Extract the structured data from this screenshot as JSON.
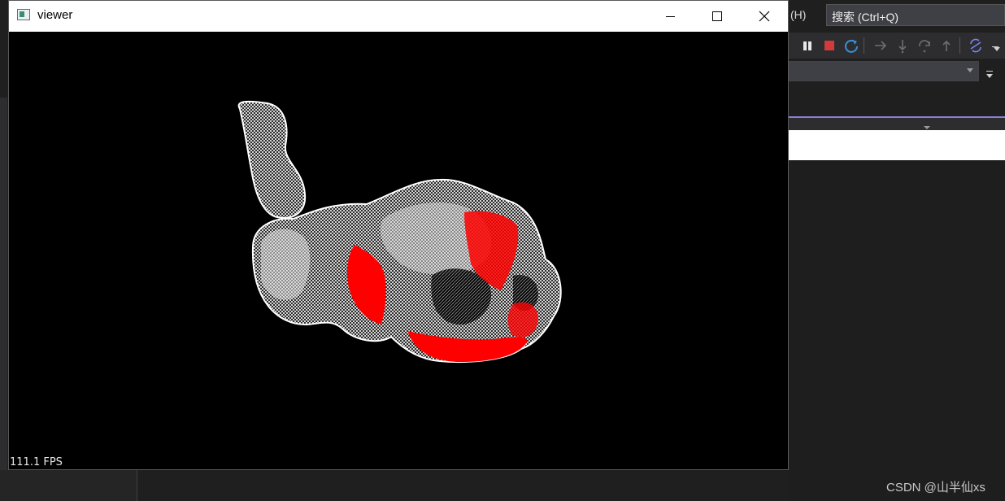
{
  "viewer": {
    "title": "viewer",
    "fps": "111.1 FPS",
    "controls": {
      "minimize": "minimize",
      "maximize": "maximize",
      "close": "close"
    }
  },
  "ide": {
    "menu_help_fragment": "(H)",
    "search_placeholder": "搜索 (Ctrl+Q)",
    "toolbar_icons": [
      "pause-icon",
      "stop-icon",
      "restart-icon",
      "step-into-arrow-icon",
      "step-down-icon",
      "step-over-icon",
      "step-out-icon",
      "hot-reload-icon"
    ]
  },
  "watermark": "CSDN @山半仙xs",
  "colors": {
    "viewer_bg": "#000000",
    "point_cloud": "#ffffff",
    "highlight": "#ff0000",
    "ide_bg": "#1f1f1f",
    "accent_line": "#8b7fd6",
    "stop_red": "#d13b3b",
    "restart_blue": "#3a8fd8"
  }
}
